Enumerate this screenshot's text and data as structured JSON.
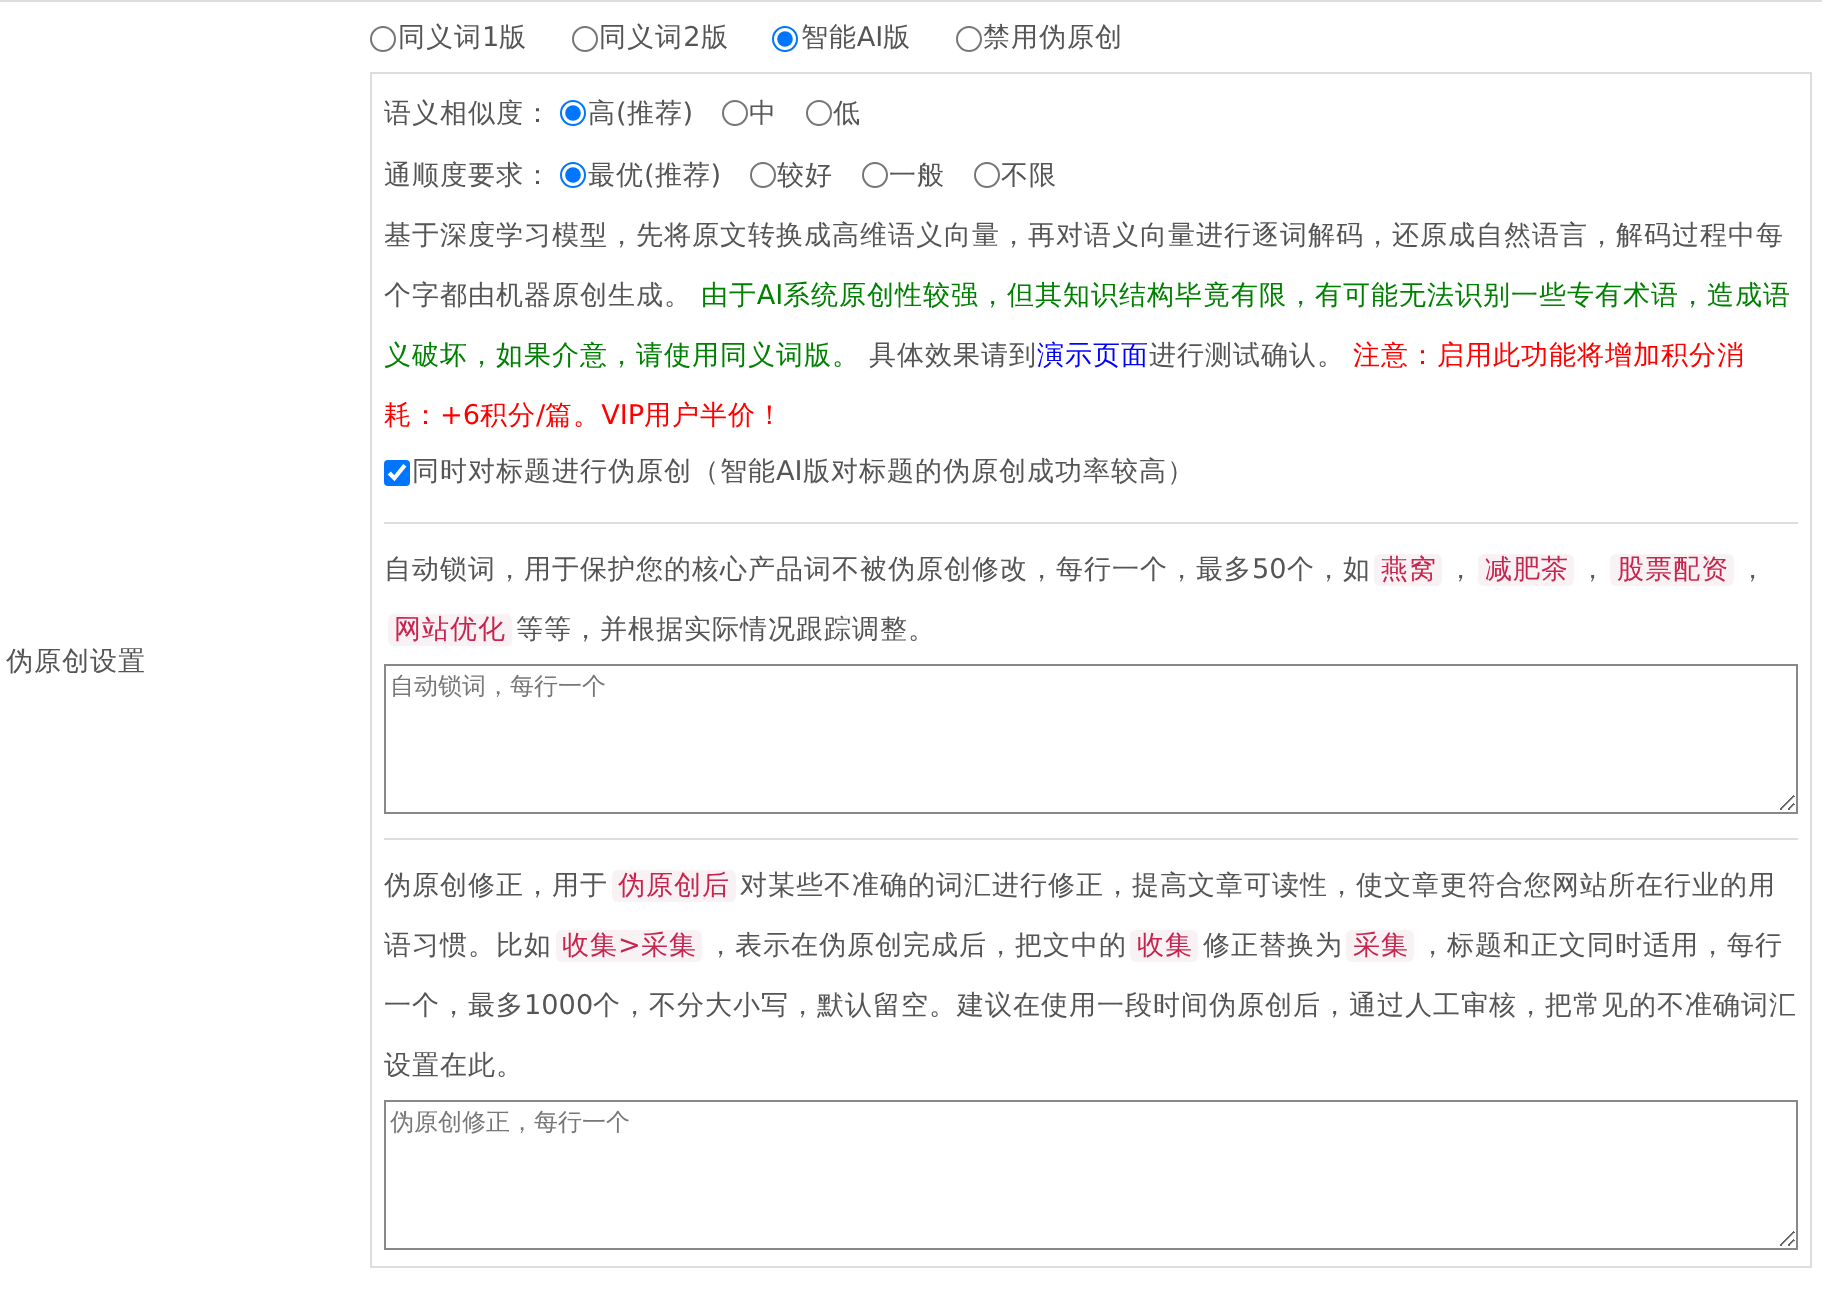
{
  "side_label": "伪原创设置",
  "modes": [
    {
      "label": "同义词1版",
      "selected": false
    },
    {
      "label": "同义词2版",
      "selected": false
    },
    {
      "label": "智能AI版",
      "selected": true
    },
    {
      "label": "禁用伪原创",
      "selected": false
    }
  ],
  "similarity": {
    "label": "语义相似度：",
    "options": [
      {
        "label": "高(推荐)",
        "selected": true
      },
      {
        "label": "中",
        "selected": false
      },
      {
        "label": "低",
        "selected": false
      }
    ]
  },
  "fluency": {
    "label": "通顺度要求：",
    "options": [
      {
        "label": "最优(推荐)",
        "selected": true
      },
      {
        "label": "较好",
        "selected": false
      },
      {
        "label": "一般",
        "selected": false
      },
      {
        "label": "不限",
        "selected": false
      }
    ]
  },
  "ai_description": [
    {
      "kind": "plain",
      "text": "基于深度学习模型，先将原文转换成高维语义向量，再对语义向量进行逐词解码，还原成自然语言，解码过程中每个字都由机器原创生成。 "
    },
    {
      "kind": "green",
      "text": "由于AI系统原创性较强，但其知识结构毕竟有限，有可能无法识别一些专有术语，造成语义破坏，如果介意，请使用同义词版。"
    },
    {
      "kind": "plain",
      "text": " 具体效果请到"
    },
    {
      "kind": "link",
      "text": "演示页面"
    },
    {
      "kind": "plain",
      "text": "进行测试确认。 "
    },
    {
      "kind": "red",
      "text": "注意：启用此功能将增加积分消耗：+6积分/篇。VIP用户半价！"
    }
  ],
  "title_option": {
    "label": "同时对标题进行伪原创（智能AI版对标题的伪原创成功率较高）",
    "checked": true
  },
  "lock_description": [
    {
      "kind": "plain",
      "text": "自动锁词，用于保护您的核心产品词不被伪原创修改，每行一个，最多50个，如"
    },
    {
      "kind": "code",
      "text": "燕窝"
    },
    {
      "kind": "plain",
      "text": "，"
    },
    {
      "kind": "code",
      "text": "减肥茶"
    },
    {
      "kind": "plain",
      "text": "，"
    },
    {
      "kind": "code",
      "text": "股票配资"
    },
    {
      "kind": "plain",
      "text": "，"
    },
    {
      "kind": "code",
      "text": "网站优化"
    },
    {
      "kind": "plain",
      "text": "等等，并根据实际情况跟踪调整。"
    }
  ],
  "lock_field": {
    "placeholder": "自动锁词，每行一个"
  },
  "fix_description": [
    {
      "kind": "plain",
      "text": "伪原创修正，用于"
    },
    {
      "kind": "code",
      "text": "伪原创后"
    },
    {
      "kind": "plain",
      "text": "对某些不准确的词汇进行修正，提高文章可读性，使文章更符合您网站所在行业的用语习惯。比如"
    },
    {
      "kind": "code",
      "text": "收集>采集"
    },
    {
      "kind": "plain",
      "text": "，表示在伪原创完成后，把文中的"
    },
    {
      "kind": "code",
      "text": "收集"
    },
    {
      "kind": "plain",
      "text": "修正替换为"
    },
    {
      "kind": "code",
      "text": "采集"
    },
    {
      "kind": "plain",
      "text": "，标题和正文同时适用，每行一个，最多1000个，不分大小写，默认留空。建议在使用一段时间伪原创后，通过人工审核，把常见的不准确词汇设置在此。"
    }
  ],
  "fix_field": {
    "placeholder": "伪原创修正，每行一个"
  }
}
